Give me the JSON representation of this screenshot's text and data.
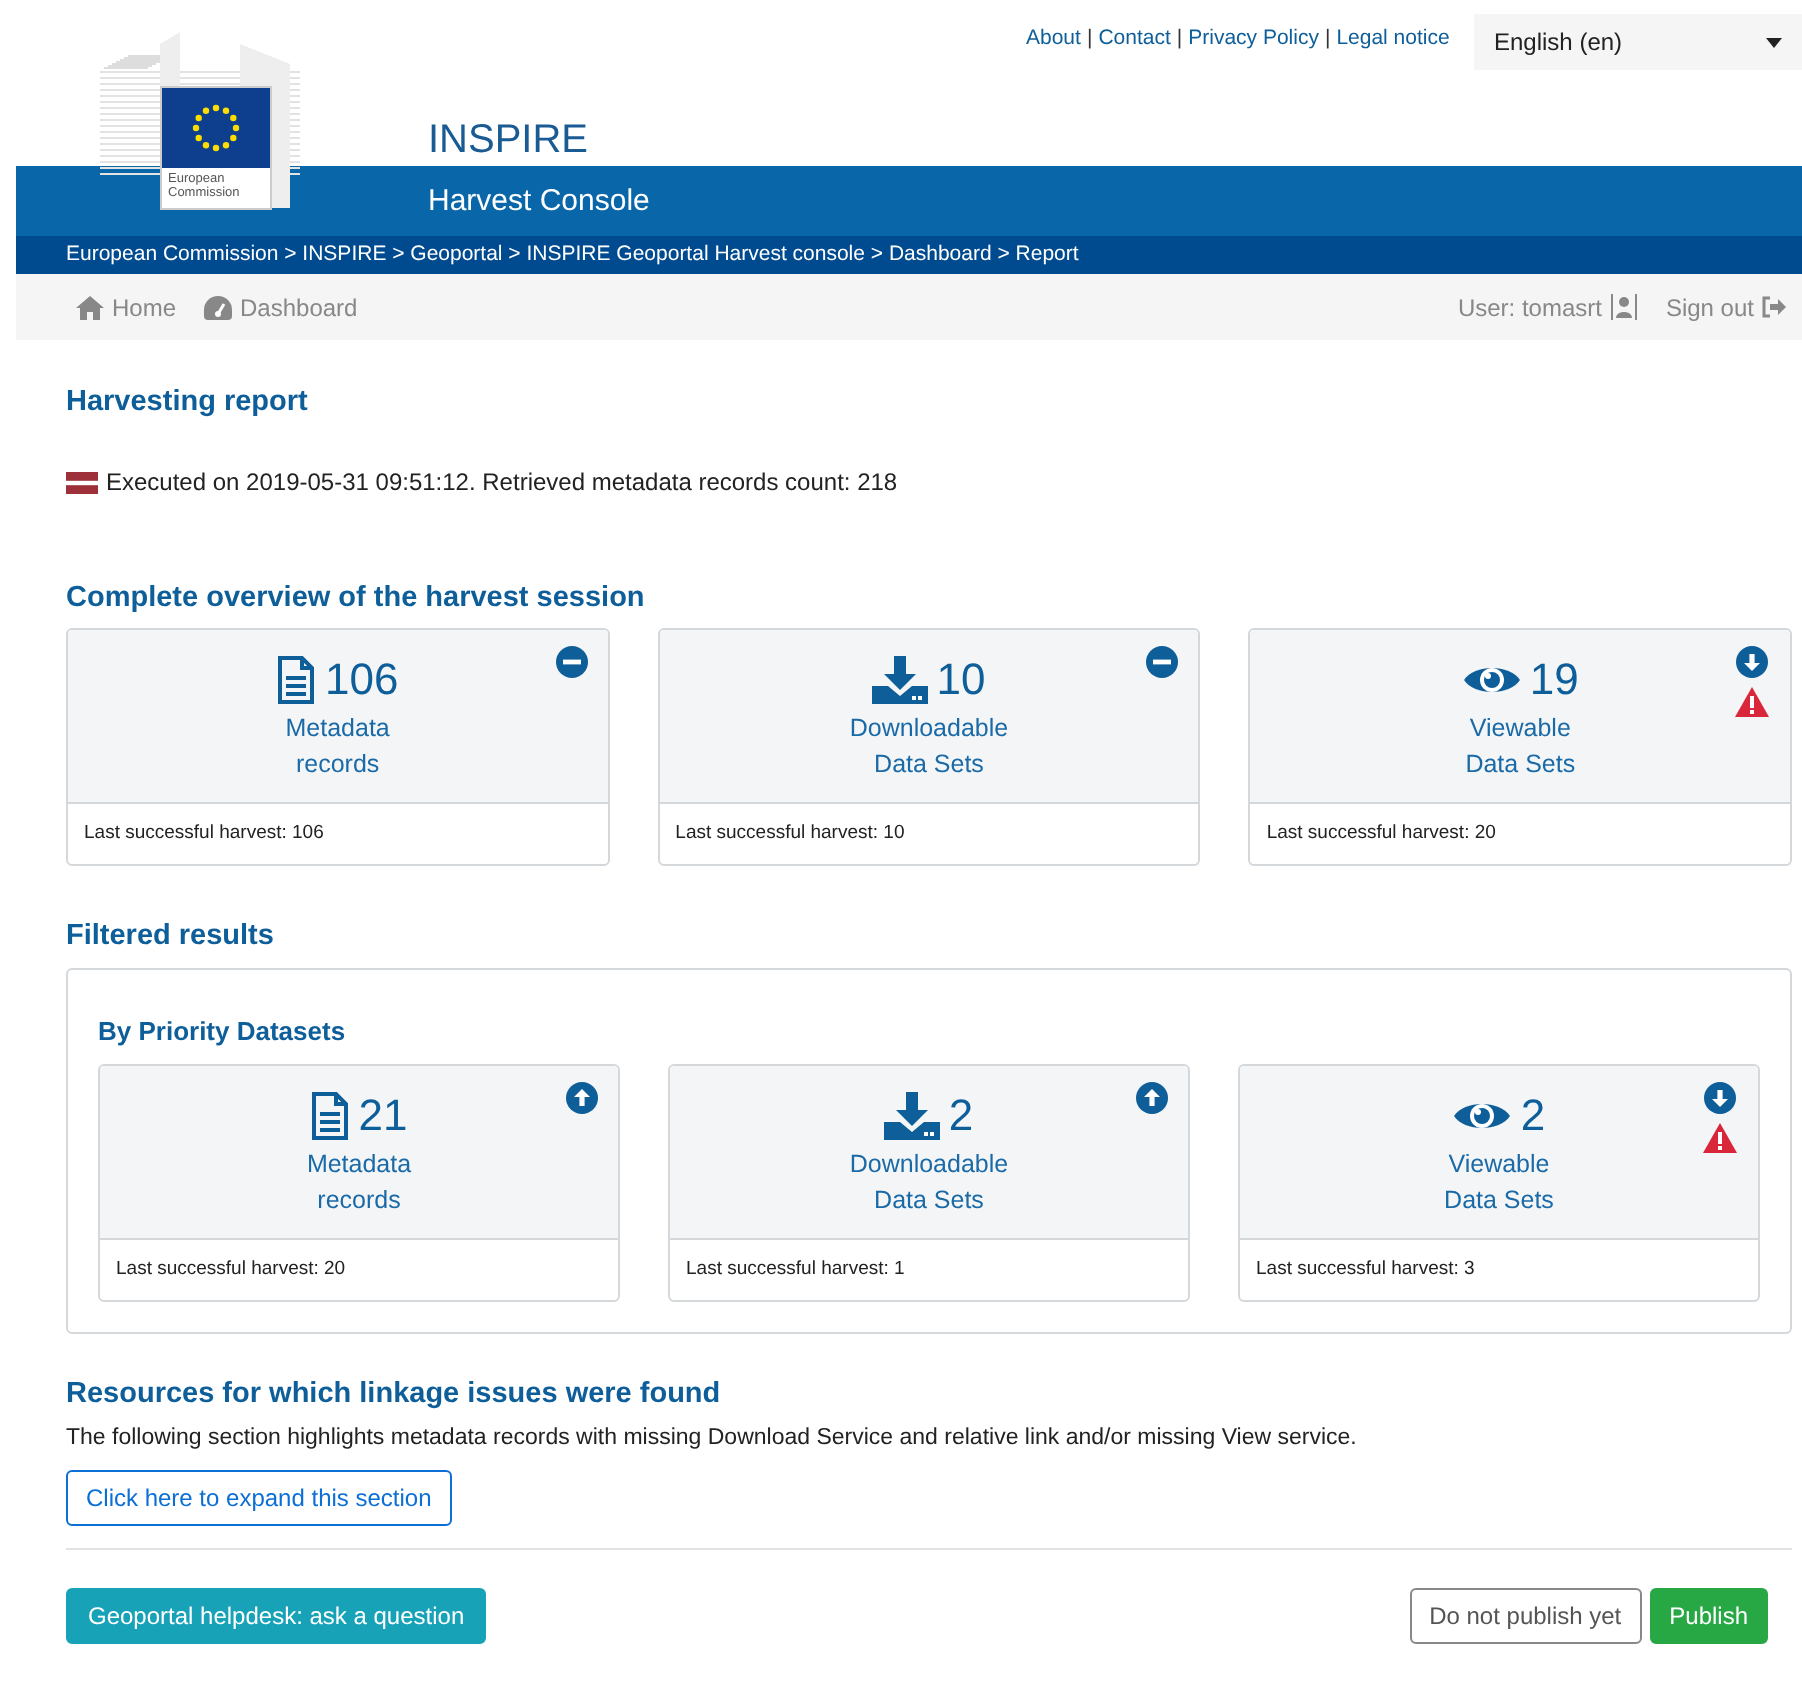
{
  "top_links": [
    "About",
    "Contact",
    "Privacy Policy",
    "Legal notice"
  ],
  "top_links_separator": "|",
  "language": {
    "value": "English (en)"
  },
  "logo": {
    "lines": [
      "European",
      "Commission"
    ]
  },
  "site_title": "INSPIRE",
  "app_title": "Harvest Console",
  "breadcrumb": "European Commission > INSPIRE > Geoportal > INSPIRE Geoportal Harvest console > Dashboard > Report",
  "nav": {
    "items": [
      {
        "label": "Home",
        "kind": "home"
      },
      {
        "label": "Dashboard",
        "kind": "dashboard"
      }
    ],
    "user": "User: tomasrt",
    "sign_out": "Sign out"
  },
  "report": {
    "title": "Harvesting report",
    "executed": "Executed on 2019-05-31 09:51:12. Retrieved metadata records count: 218"
  },
  "overview": {
    "title": "Complete overview of the harvest session",
    "cards": [
      {
        "kind": "document",
        "count": "106",
        "label": [
          "Metadata",
          "records"
        ],
        "indicator": {
          "kind": "minus"
        },
        "warning": false,
        "footer": "Last successful harvest: 106"
      },
      {
        "kind": "download",
        "count": "10",
        "label": [
          "Downloadable",
          "Data Sets"
        ],
        "indicator": {
          "kind": "minus"
        },
        "warning": false,
        "footer": "Last successful harvest: 10"
      },
      {
        "kind": "eye",
        "count": "19",
        "label": [
          "Viewable",
          "Data Sets"
        ],
        "indicator": {
          "kind": "down"
        },
        "warning": true,
        "footer": "Last successful harvest: 20"
      }
    ]
  },
  "filtered": {
    "title": "Filtered results",
    "subtitle": "By Priority Datasets",
    "cards": [
      {
        "kind": "document",
        "count": "21",
        "label": [
          "Metadata",
          "records"
        ],
        "indicator": {
          "kind": "up"
        },
        "warning": false,
        "footer": "Last successful harvest: 20"
      },
      {
        "kind": "download",
        "count": "2",
        "label": [
          "Downloadable",
          "Data Sets"
        ],
        "indicator": {
          "kind": "up"
        },
        "warning": false,
        "footer": "Last successful harvest: 1"
      },
      {
        "kind": "eye",
        "count": "2",
        "label": [
          "Viewable",
          "Data Sets"
        ],
        "indicator": {
          "kind": "down"
        },
        "warning": true,
        "footer": "Last successful harvest: 3"
      }
    ]
  },
  "linkage": {
    "title": "Resources for which linkage issues were found",
    "text": "The following section highlights metadata records with missing Download Service and relative link and/or missing View service.",
    "expand_button": "Click here to expand this section"
  },
  "footer": {
    "helpdesk_button": "Geoportal helpdesk: ask a question",
    "not_publish_button": "Do not publish yet",
    "publish_button": "Publish"
  }
}
